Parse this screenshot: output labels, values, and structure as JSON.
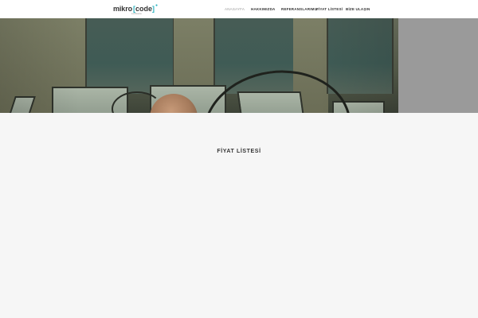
{
  "header": {
    "logo": {
      "word": "mikro",
      "bracket_open": "[",
      "code": "code",
      "bracket_close": "]",
      "tagline": "software"
    },
    "nav": [
      {
        "label": "ANASAYFA",
        "active": true
      },
      {
        "label": "HAKKIMIZDA",
        "active": false
      },
      {
        "label": "REFERANSLARIMIZ",
        "active": false
      },
      {
        "label": "FİYAT LİSTESİ",
        "active": false
      },
      {
        "label": "BİZE ULAŞIN",
        "active": false
      }
    ]
  },
  "hero": {
    "image": "office-meeting-photo"
  },
  "main": {
    "section_title": "FİYAT LİSTESİ"
  },
  "colors": {
    "accent": "#2bb3c0",
    "background": "#f6f6f6",
    "header": "#ffffff",
    "text": "#333333",
    "nav_active": "#9a9a9a"
  }
}
